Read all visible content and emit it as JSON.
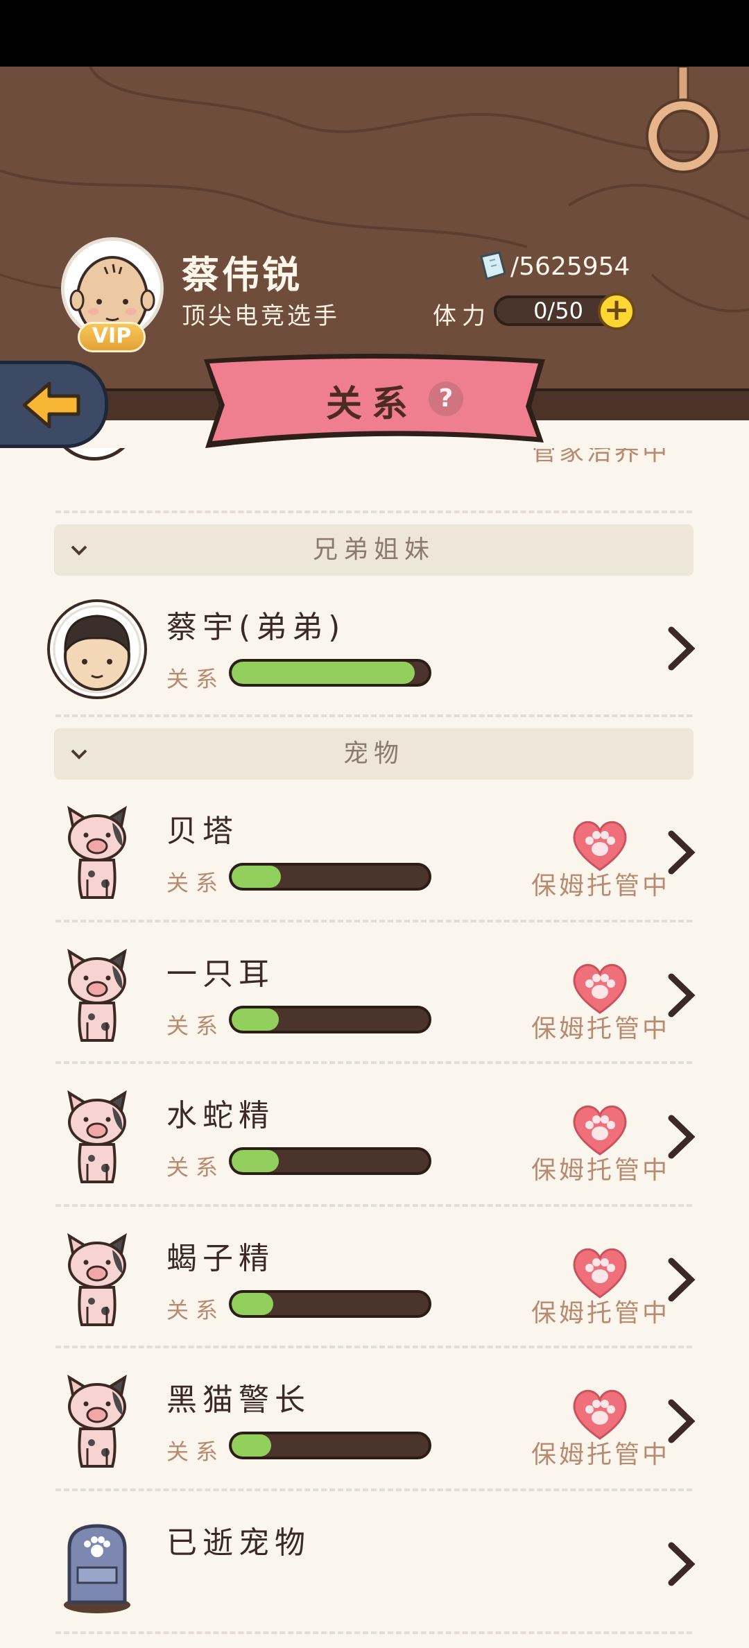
{
  "profile": {
    "name": "蔡伟锐",
    "title": "顶尖电竞选手",
    "vip": "VIP",
    "coins": "/5625954",
    "stamina_label": "体力",
    "stamina_value": "0/50",
    "stamina_plus": "+"
  },
  "banner": {
    "title": "关系",
    "help": "?"
  },
  "sections": {
    "siblings": "兄弟姐妹",
    "pets": "宠物"
  },
  "partial_row": {
    "status": "管家治养中"
  },
  "sibling": {
    "name": "蔡宇(弟弟)",
    "relation_label": "关系",
    "relation_level": 0.93
  },
  "pets": [
    {
      "name": "贝塔",
      "relation_label": "关系",
      "relation_level": 0.25,
      "status": "保姆托管中"
    },
    {
      "name": "一只耳",
      "relation_label": "关系",
      "relation_level": 0.24,
      "status": "保姆托管中"
    },
    {
      "name": "水蛇精",
      "relation_label": "关系",
      "relation_level": 0.24,
      "status": "保姆托管中"
    },
    {
      "name": "蝎子精",
      "relation_label": "关系",
      "relation_level": 0.21,
      "status": "保姆托管中"
    },
    {
      "name": "黑猫警长",
      "relation_label": "关系",
      "relation_level": 0.2,
      "status": "保姆托管中"
    }
  ],
  "deceased": {
    "name": "已逝宠物"
  },
  "colors": {
    "bar_fill": "#92cf5c",
    "bar_bg": "#4a342b",
    "banner": "#ef7f8e",
    "wood": "#6e4d3c"
  }
}
